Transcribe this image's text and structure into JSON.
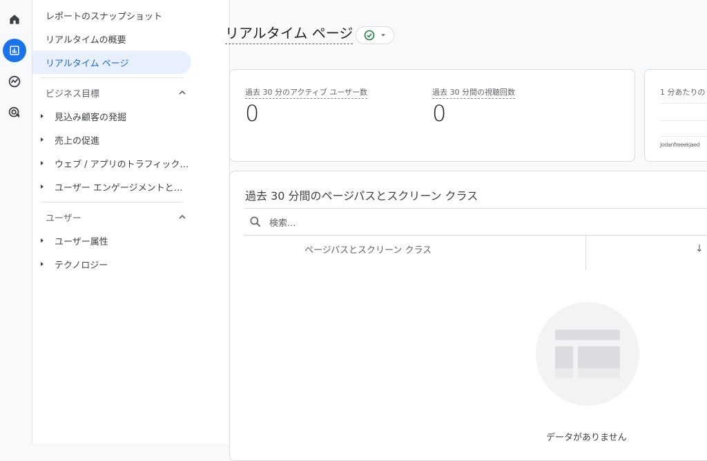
{
  "nav": {
    "items": [
      {
        "label": "レポートのスナップショット"
      },
      {
        "label": "リアルタイムの概要"
      },
      {
        "label": "リアルタイム ページ"
      }
    ],
    "sections": [
      {
        "title": "ビジネス目標",
        "items": [
          {
            "label": "見込み顧客の発掘"
          },
          {
            "label": "売上の促進"
          },
          {
            "label": "ウェブ / アプリのトラフィック…"
          },
          {
            "label": "ユーザー エンゲージメントと…"
          }
        ]
      },
      {
        "title": "ユーザー",
        "items": [
          {
            "label": "ユーザー属性"
          },
          {
            "label": "テクノロジー"
          }
        ]
      }
    ]
  },
  "rail": {
    "icons": [
      "home-icon",
      "reports-icon",
      "explore-icon",
      "advertising-icon"
    ],
    "active": "reports-icon"
  },
  "main": {
    "title": "リアルタイム ページ",
    "status_icon": "check-circle-icon",
    "metrics": [
      {
        "label": "過去 30 分のアクティブ ユーザー数",
        "value": "0"
      },
      {
        "label": "過去 30 分間の視聴回数",
        "value": "0"
      }
    ],
    "side_card": {
      "label": "1 分あたりの",
      "axis_text": "Jodanfreeekjaed"
    },
    "table": {
      "title": "過去 30 分間のページパスとスクリーン クラス",
      "search_placeholder": "検索...",
      "column_header": "ページパスとスクリーン クラス",
      "sort_indicator": "↓",
      "empty_text": "データがありません"
    }
  },
  "colors": {
    "accent": "#1a73e8",
    "selected_bg": "#e8f0fe",
    "selected_text": "#1967d2",
    "status_green": "#188038"
  }
}
